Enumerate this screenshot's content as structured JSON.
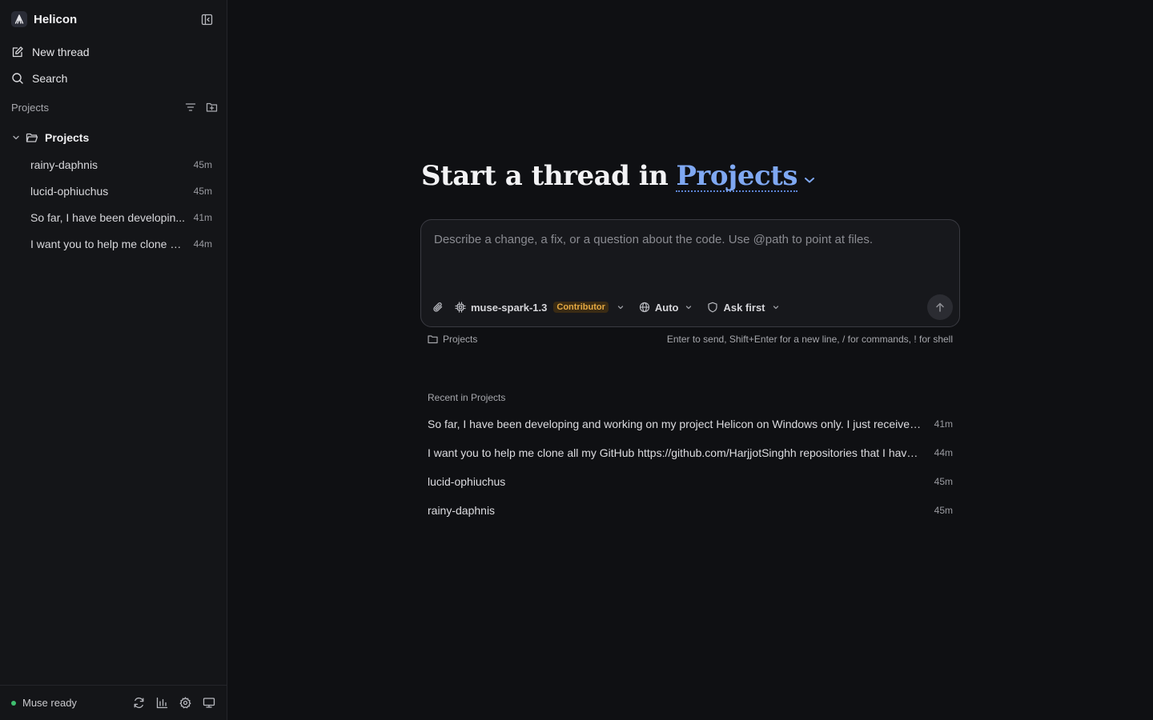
{
  "app": {
    "name": "Helicon"
  },
  "sidebar": {
    "nav": [
      {
        "label": "New thread",
        "icon": "pencil-square-icon"
      },
      {
        "label": "Search",
        "icon": "search-icon"
      }
    ],
    "section_label": "Projects",
    "folder": {
      "name": "Projects",
      "expanded": true
    },
    "threads": [
      {
        "title": "rainy-daphnis",
        "time": "45m"
      },
      {
        "title": "lucid-ophiuchus",
        "time": "45m"
      },
      {
        "title": "So far, I have been developin...",
        "time": "41m"
      },
      {
        "title": "I want you to help me clone al...",
        "time": "44m"
      }
    ],
    "footer": {
      "status": "Muse ready",
      "status_color": "#3fbf6f"
    }
  },
  "main": {
    "headline_prefix": "Start a thread in",
    "headline_project": "Projects",
    "composer": {
      "placeholder": "Describe a change, a fix, or a question about the code. Use @path to point at files.",
      "value": "",
      "model": "muse-spark-1.3",
      "model_badge": "Contributor",
      "mode": "Auto",
      "permission": "Ask first"
    },
    "location": "Projects",
    "hint": "Enter to send, Shift+Enter for a new line, / for commands, ! for shell",
    "recent_label": "Recent in Projects",
    "recent": [
      {
        "title": "So far, I have been developing and working on my project Helicon on Windows only. I just received...",
        "time": "41m"
      },
      {
        "title": "I want you to help me clone all my GitHub https://github.com/HarjjotSinghh repositories that I have ...",
        "time": "44m"
      },
      {
        "title": "lucid-ophiuchus",
        "time": "45m"
      },
      {
        "title": "rainy-daphnis",
        "time": "45m"
      }
    ]
  },
  "colors": {
    "accent": "#7fa8f2",
    "badge_text": "#e5a942",
    "background": "#0f1013",
    "sidebar": "#141518"
  }
}
